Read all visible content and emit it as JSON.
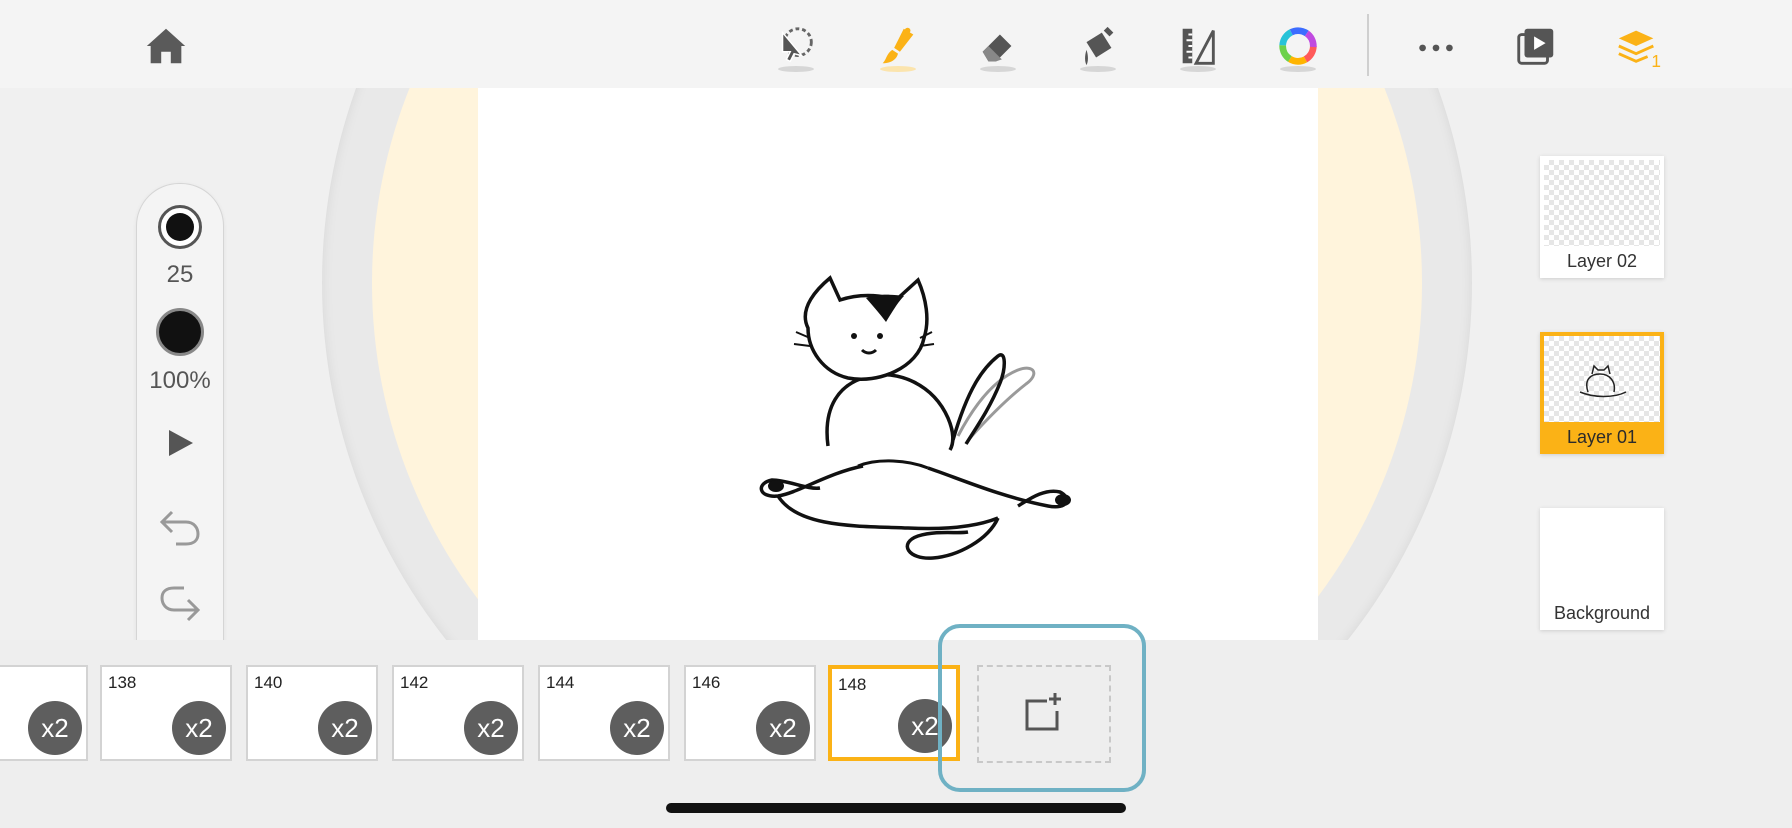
{
  "toolbar": {
    "icons": [
      "home-icon",
      "lasso-select-icon",
      "brush-icon",
      "eraser-icon",
      "paint-bucket-icon",
      "ruler-icon",
      "color-wheel-icon",
      "more-icon",
      "playback-icon",
      "layers-icon"
    ],
    "layers_count": "1",
    "accent_color": "#fbb216"
  },
  "brush_panel": {
    "size_value": "25",
    "opacity_value": "100%"
  },
  "layers": [
    {
      "label": "Layer 02"
    },
    {
      "label": "Layer 01"
    },
    {
      "label": "Background"
    }
  ],
  "timeline": {
    "frames": [
      {
        "number": "",
        "multiplier": "x2"
      },
      {
        "number": "138",
        "multiplier": "x2"
      },
      {
        "number": "140",
        "multiplier": "x2"
      },
      {
        "number": "142",
        "multiplier": "x2"
      },
      {
        "number": "144",
        "multiplier": "x2"
      },
      {
        "number": "146",
        "multiplier": "x2"
      },
      {
        "number": "148",
        "multiplier": "x2"
      }
    ]
  }
}
